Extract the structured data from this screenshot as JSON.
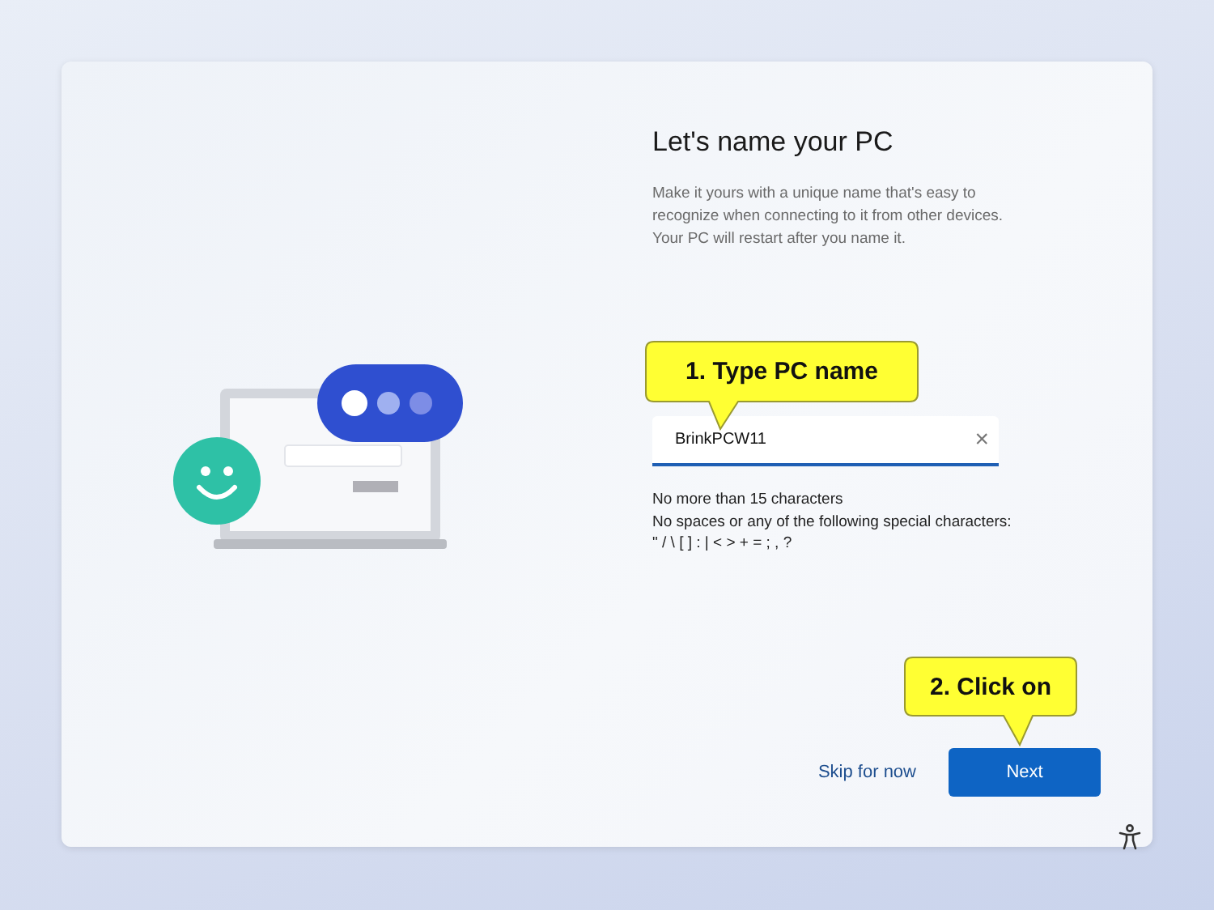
{
  "title": "Let's name your PC",
  "description": "Make it yours with a unique name that's easy to recognize when connecting to it from other devices. Your PC will restart after you name it.",
  "name_field": {
    "value": "BrinkPCW11",
    "clear": "×"
  },
  "rules": [
    "No more than 15 characters",
    "No spaces or any of the following special characters:",
    "\" / \\ [ ] : | < > + = ; , ?"
  ],
  "callouts": [
    {
      "text": "1. Type PC name"
    },
    {
      "text": "2. Click on"
    }
  ],
  "buttons": [
    {
      "kind": "link",
      "label": "Skip for now"
    },
    {
      "kind": "primary",
      "label": "Next"
    }
  ]
}
